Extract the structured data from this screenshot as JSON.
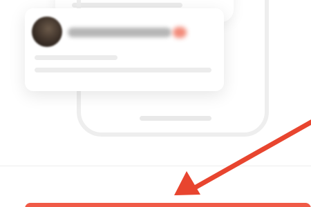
{
  "illustration": {
    "phone_outline_color": "#eeeeee",
    "card_shadow": "soft-grey",
    "avatar_icon": "avatar-icon",
    "redacted_name": "",
    "redacted_badge_color": "#ef6e59"
  },
  "annotation": {
    "arrow_icon": "arrow-pointer-icon",
    "arrow_color": "#e8452f"
  },
  "action_bar": {
    "color": "#f05a47",
    "label": ""
  }
}
